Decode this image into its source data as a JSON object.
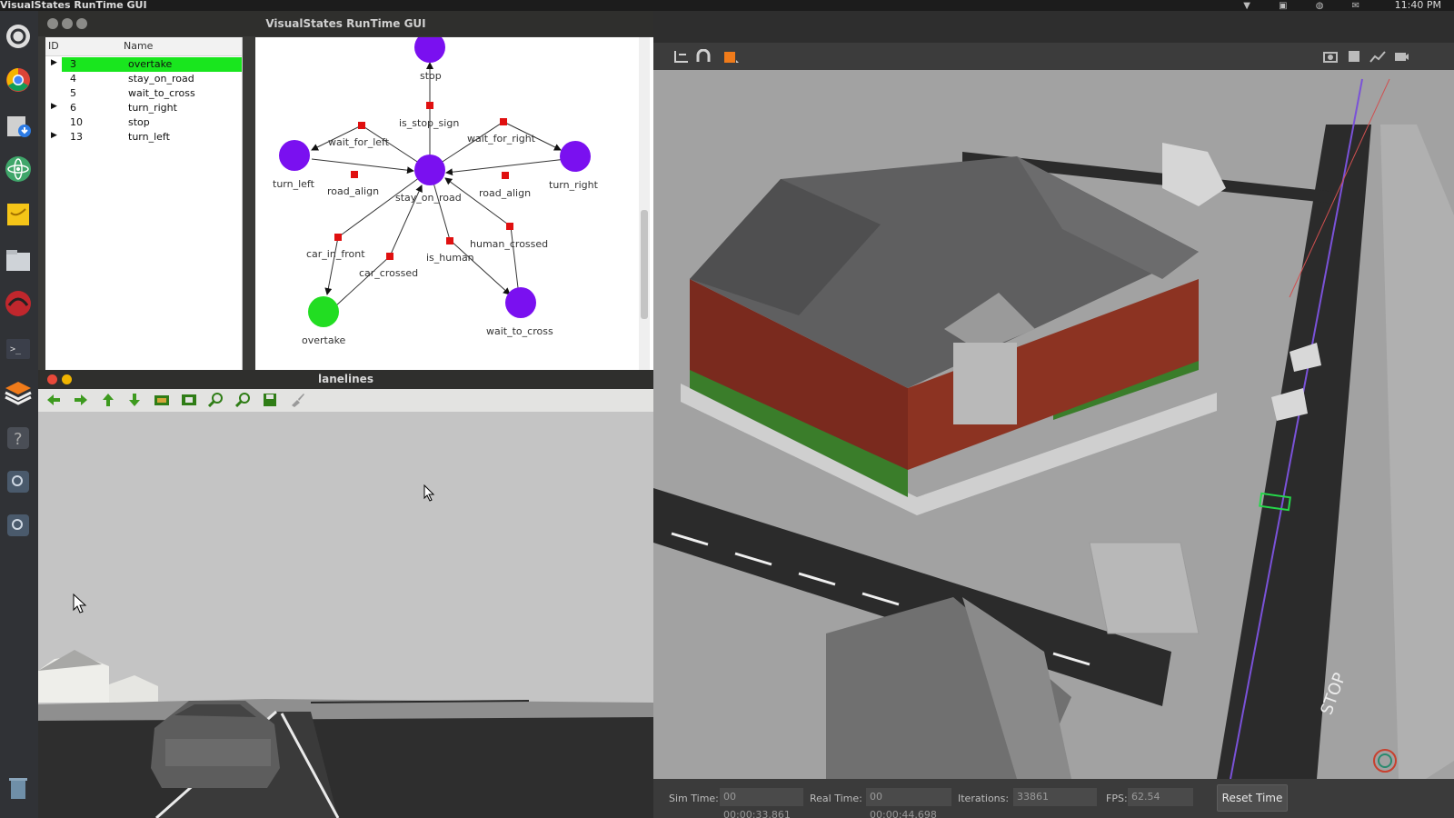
{
  "system_bar": {
    "app_title": "VisualStates RunTime GUI",
    "clock": "11:40 PM"
  },
  "state_window": {
    "title": "VisualStates RunTime GUI",
    "tree": {
      "columns": [
        "ID",
        "Name"
      ],
      "rows": [
        {
          "expander": "▶",
          "id": "3",
          "name": "overtake",
          "selected": true
        },
        {
          "expander": "",
          "id": "4",
          "name": "stay_on_road",
          "selected": false
        },
        {
          "expander": "",
          "id": "5",
          "name": "wait_to_cross",
          "selected": false
        },
        {
          "expander": "▶",
          "id": "6",
          "name": "turn_right",
          "selected": false
        },
        {
          "expander": "",
          "id": "10",
          "name": "stop",
          "selected": false
        },
        {
          "expander": "▶",
          "id": "13",
          "name": "turn_left",
          "selected": false
        }
      ]
    },
    "graph": {
      "states": {
        "stop": "stop",
        "turn_left": "turn_left",
        "stay_on_road": "stay_on_road",
        "turn_right": "turn_right",
        "overtake": "overtake",
        "wait_to_cross": "wait_to_cross"
      },
      "transitions": {
        "is_stop_sign": "is_stop_sign",
        "wait_for_left": "wait_for_left",
        "wait_for_right": "wait_for_right",
        "road_align_left": "road_align",
        "road_align_right": "road_align",
        "car_in_front": "car_in_front",
        "car_crossed": "car_crossed",
        "is_human": "is_human",
        "human_crossed": "human_crossed"
      },
      "colors": {
        "active": "#22dd22",
        "inactive": "#7a10f0",
        "transition": "#e01010"
      }
    }
  },
  "lane_window": {
    "title": "lanelines",
    "toolbar": [
      "back-arrow-icon",
      "forward-arrow-icon",
      "up-arrow-icon",
      "down-arrow-icon",
      "home-icon",
      "fit-icon",
      "zoom-in-icon",
      "zoom-out-icon",
      "save-icon",
      "brush-icon"
    ]
  },
  "gazebo": {
    "stats": {
      "sim_time_label": "Sim Time:",
      "sim_time": "00 00:00:33.861",
      "real_time_label": "Real Time:",
      "real_time": "00 00:00:44.698",
      "iterations_label": "Iterations:",
      "iterations": "33861",
      "fps_label": "FPS:",
      "fps": "62.54"
    },
    "reset_button": "Reset Time",
    "road_marking": "STOP"
  }
}
